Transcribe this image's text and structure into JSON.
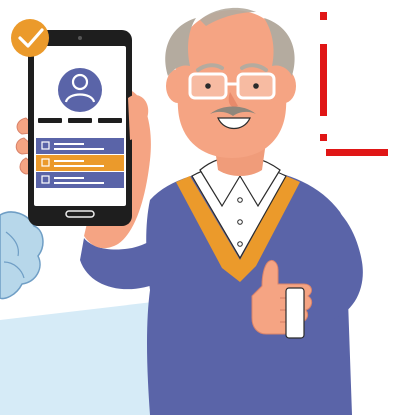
{
  "scene": {
    "subject": "elderly-man-holding-smartphone-thumbs-up",
    "icons": [
      "checkmark-badge-icon",
      "user-avatar-icon",
      "thumbs-up-icon"
    ]
  },
  "phone_screen": {
    "list_items": [
      {
        "checked": false,
        "highlighted": false
      },
      {
        "checked": false,
        "highlighted": true
      },
      {
        "checked": false,
        "highlighted": false
      }
    ]
  },
  "colors": {
    "accent_blue": "#5a64a8",
    "accent_orange": "#eb9a2b",
    "skin": "#f5a483",
    "hair": "#b4ab9f",
    "phone_body": "#1e1e1e",
    "light_blue_bg": "#d6ebf7",
    "red_mark": "#e01616"
  }
}
